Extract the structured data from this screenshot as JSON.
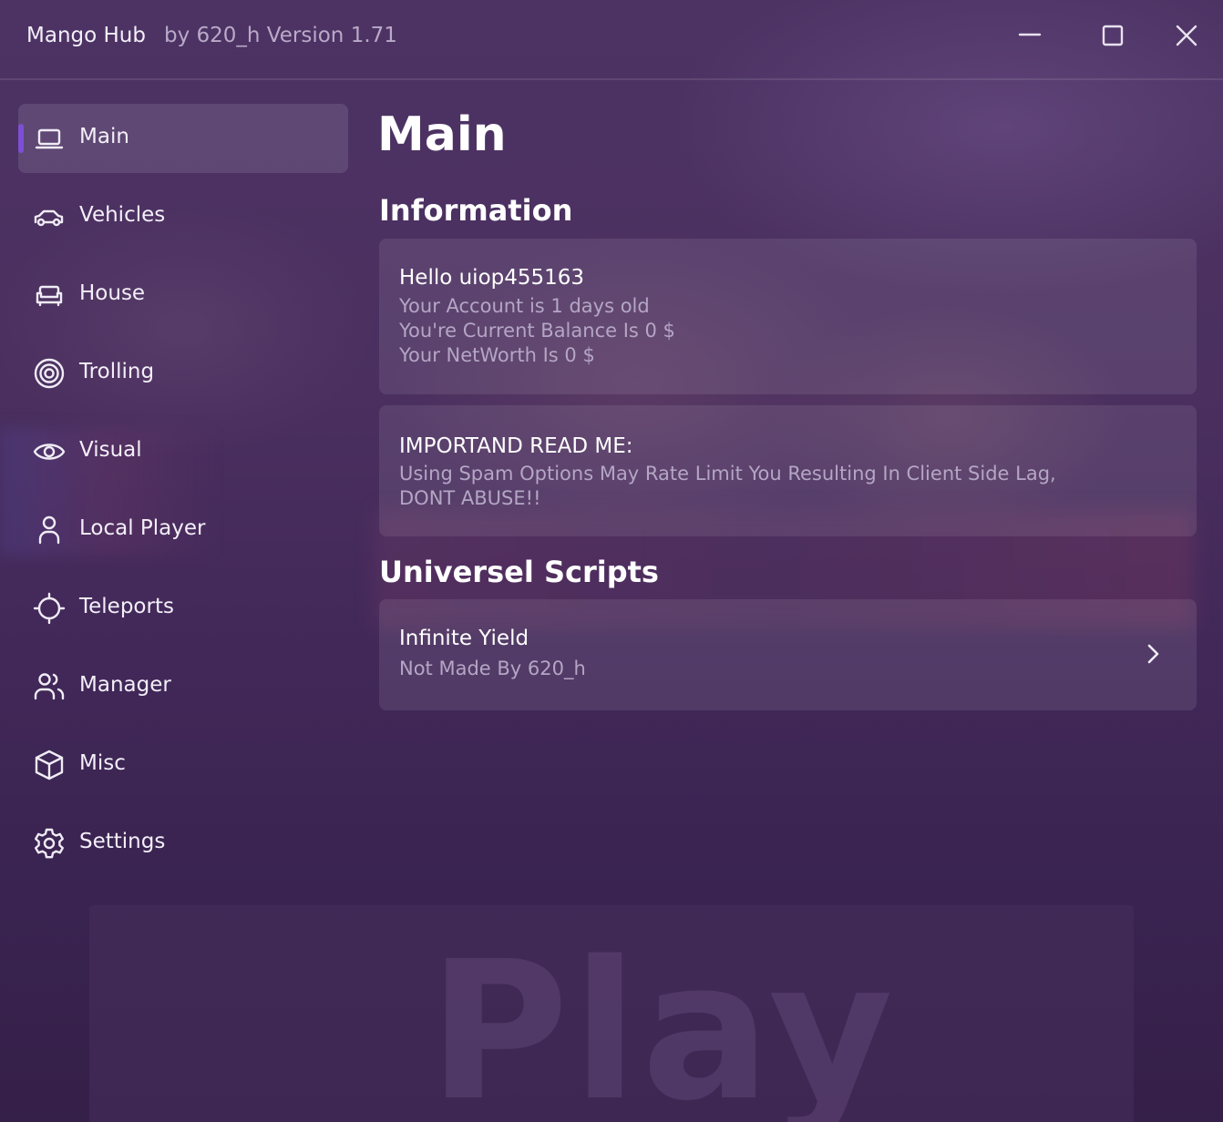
{
  "window": {
    "title": "Mango Hub",
    "subtitle": "by 620_h Version 1.71"
  },
  "sidebar": {
    "items": [
      {
        "label": "Main",
        "icon": "laptop-icon",
        "active": true
      },
      {
        "label": "Vehicles",
        "icon": "car-icon"
      },
      {
        "label": "House",
        "icon": "sofa-icon"
      },
      {
        "label": "Trolling",
        "icon": "target-icon"
      },
      {
        "label": "Visual",
        "icon": "eye-icon"
      },
      {
        "label": "Local Player",
        "icon": "user-icon"
      },
      {
        "label": "Teleports",
        "icon": "crosshair-icon"
      },
      {
        "label": "Manager",
        "icon": "users-icon"
      },
      {
        "label": "Misc",
        "icon": "box-icon"
      },
      {
        "label": "Settings",
        "icon": "gear-icon"
      }
    ]
  },
  "main": {
    "title": "Main",
    "information": {
      "heading": "Information",
      "account_card": {
        "title": "Hello uiop455163",
        "lines": [
          "Your Account is 1 days old",
          "You're Current Balance Is 0 $",
          "Your NetWorth Is 0 $"
        ]
      },
      "notice_card": {
        "title": "IMPORTAND READ ME:",
        "lines": [
          "Using Spam Options May Rate Limit You Resulting In Client Side Lag,",
          "DONT ABUSE!!"
        ]
      }
    },
    "scripts": {
      "heading": "Universel Scripts",
      "items": [
        {
          "title": "Infinite Yield",
          "subtitle": "Not Made By 620_h"
        }
      ]
    }
  },
  "background": {
    "play_label": "Play"
  },
  "colors": {
    "accent": "#7d4fd4",
    "background": "#432a5a"
  }
}
